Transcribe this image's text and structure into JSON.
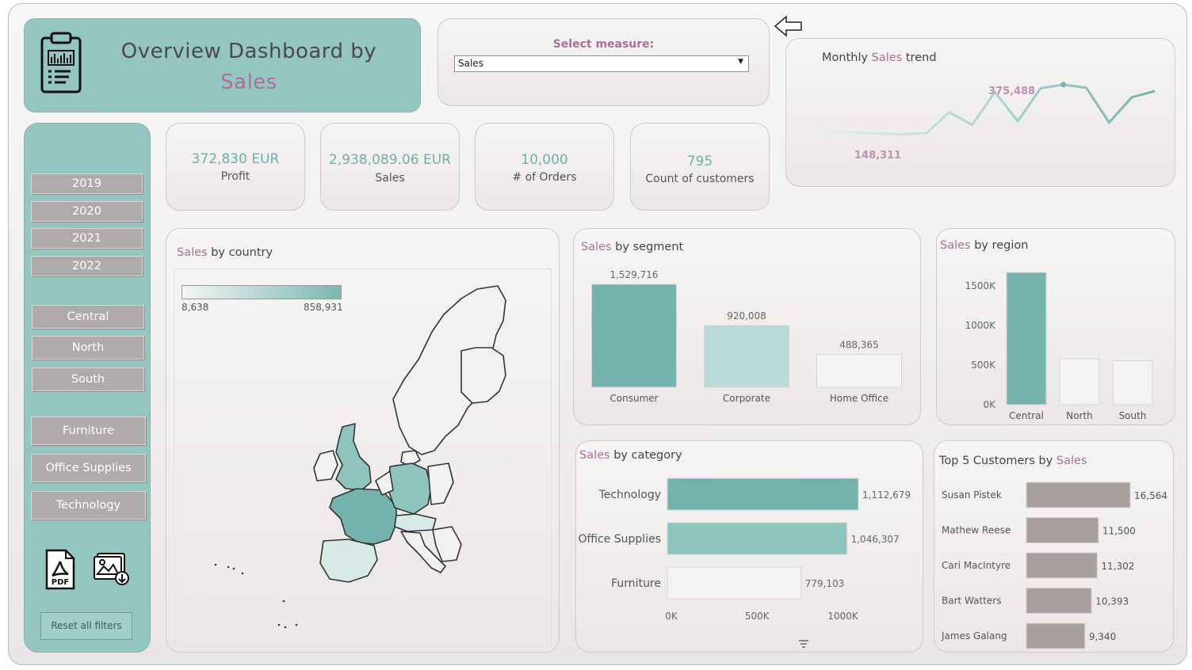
{
  "header": {
    "title_prefix": "Overview Dashboard by",
    "title_measure": "Sales"
  },
  "measure_selector": {
    "label": "Select measure:",
    "value": "Sales"
  },
  "trend": {
    "title_prefix": "Monthly ",
    "title_measure": "Sales",
    "title_suffix": " trend",
    "max_label": "375,488",
    "min_label": "148,311"
  },
  "sidebar": {
    "years": [
      "2019",
      "2020",
      "2021",
      "2022"
    ],
    "regions": [
      "Central",
      "North",
      "South"
    ],
    "categories": [
      "Furniture",
      "Office Supplies",
      "Technology"
    ],
    "reset_label": "Reset all filters",
    "pdf_icon_text": "PDF"
  },
  "kpis": [
    {
      "value": "372,830 EUR",
      "label": "Profit"
    },
    {
      "value": "2,938,089.06 EUR",
      "label": "Sales"
    },
    {
      "value": "10,000",
      "label": "# of Orders"
    },
    {
      "value": "795",
      "label": "Count of customers"
    }
  ],
  "map": {
    "title_measure": "Sales",
    "title_suffix": " by country",
    "legend_min": "8,638",
    "legend_max": "858,931"
  },
  "segment": {
    "title_measure": "Sales",
    "title_suffix": " by segment"
  },
  "region": {
    "title_measure": "Sales",
    "title_suffix": " by region"
  },
  "category": {
    "title_measure": "Sales",
    "title_suffix": " by category"
  },
  "top5": {
    "title_prefix": "Top 5 Customers by ",
    "title_measure": "Sales"
  },
  "colors": {
    "teal": "#94c5c1",
    "dark_teal": "#74b3ad",
    "accent": "#a9719a",
    "filter_gray": "#afabab",
    "bar_gray": "#a8a09f"
  },
  "chart_data": [
    {
      "type": "line",
      "title": "Monthly Sales trend",
      "values": [
        148311,
        175000,
        172000,
        168000,
        165000,
        170000,
        258000,
        205000,
        344000,
        220000,
        360000,
        375488,
        362000,
        215000,
        322000,
        348000
      ],
      "annotations": [
        "375,488",
        "148,311"
      ]
    },
    {
      "type": "bar",
      "title": "Sales by segment",
      "categories": [
        "Consumer",
        "Corporate",
        "Home Office"
      ],
      "values": [
        1529716,
        920008,
        488365
      ],
      "value_labels": [
        "1,529,716",
        "920,008",
        "488,365"
      ]
    },
    {
      "type": "bar",
      "title": "Sales by region",
      "categories": [
        "Central",
        "North",
        "South"
      ],
      "values": [
        1670000,
        580000,
        555000
      ],
      "yticks": [
        "1500K",
        "1000K",
        "500K",
        "0K"
      ],
      "ylim": [
        0,
        1700000
      ]
    },
    {
      "type": "bar",
      "title": "Sales by category",
      "orientation": "horizontal",
      "categories": [
        "Technology",
        "Office Supplies",
        "Furniture"
      ],
      "values": [
        1112679,
        1046307,
        779103
      ],
      "value_labels": [
        "1,112,679",
        "1,046,307",
        "779,103"
      ],
      "xticks": [
        "0K",
        "500K",
        "1000K"
      ]
    },
    {
      "type": "bar",
      "title": "Top 5 Customers by Sales",
      "orientation": "horizontal",
      "categories": [
        "Susan Pistek",
        "Mathew Reese",
        "Cari MacIntyre",
        "Bart Watters",
        "James Galang"
      ],
      "values": [
        16564,
        11500,
        11302,
        10393,
        9340
      ],
      "value_labels": [
        "16,564",
        "11,500",
        "11,302",
        "10,393",
        "9,340"
      ]
    }
  ]
}
